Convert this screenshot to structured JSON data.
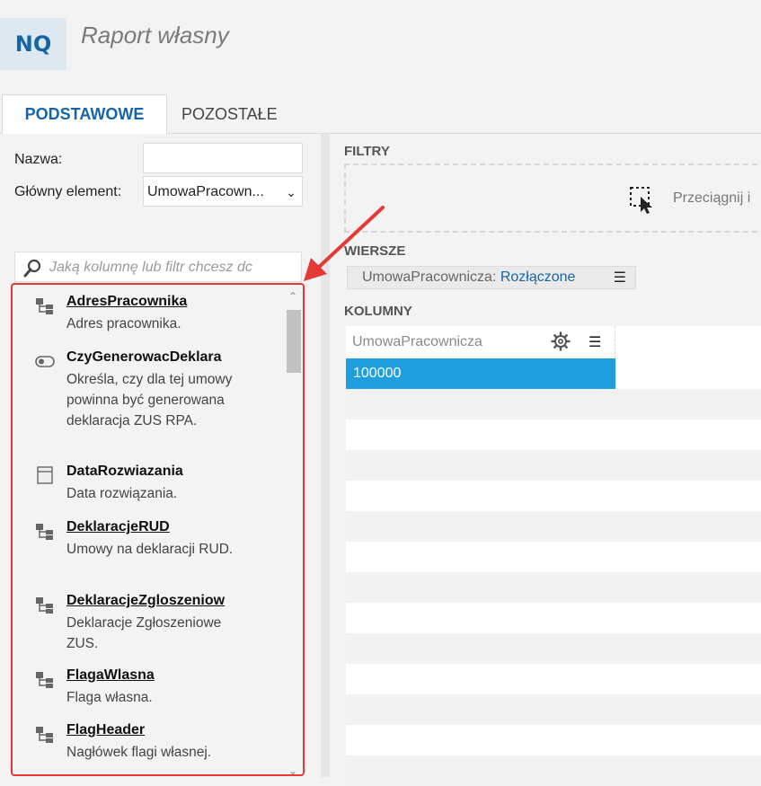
{
  "app": {
    "badge": "NQ",
    "title": "Raport własny"
  },
  "tabs": [
    {
      "label": "PODSTAWOWE",
      "active": true
    },
    {
      "label": "POZOSTAŁE",
      "active": false
    }
  ],
  "form": {
    "name_label": "Nazwa:",
    "name_value": "",
    "main_element_label": "Główny element:",
    "main_element_value": "UmowaPracown..."
  },
  "search": {
    "placeholder": "Jaką kolumnę lub filtr chcesz dc"
  },
  "fields": [
    {
      "name": "AdresPracownika",
      "desc": "Adres pracownika.",
      "icon": "tree-icon",
      "link": true
    },
    {
      "name": "CzyGenerowacDeklara",
      "desc": "Określa, czy dla tej umowy powinna być generowana deklaracja ZUS RPA.",
      "icon": "toggle-icon",
      "link": false
    },
    {
      "name": "DataRozwiazania",
      "desc": "Data rozwiązania.",
      "icon": "calendar-icon",
      "link": false
    },
    {
      "name": "DeklaracjeRUD",
      "desc": "Umowy na deklaracji RUD.",
      "icon": "tree-icon",
      "link": true
    },
    {
      "name": "DeklaracjeZgloszeniow",
      "desc": "Deklaracje Zgłoszeniowe ZUS.",
      "icon": "tree-icon",
      "link": true
    },
    {
      "name": "FlagaWlasna",
      "desc": "Flaga własna.",
      "icon": "tree-icon",
      "link": true
    },
    {
      "name": "FlagHeader",
      "desc": "Nagłówek flagi własnej.",
      "icon": "tree-icon",
      "link": true
    }
  ],
  "right": {
    "filters_label": "FILTRY",
    "drop_text": "Przeciągnij i",
    "rows_label": "WIERSZE",
    "row_chip_prefix": "UmowaPracownicza:",
    "row_chip_value": "Rozłączone",
    "columns_label": "KOLUMNY",
    "column_name": "UmowaPracownicza",
    "cell_value": "100000"
  },
  "colors": {
    "accent": "#1565a8",
    "selection": "#1f9ee0",
    "highlight": "#e53935"
  }
}
